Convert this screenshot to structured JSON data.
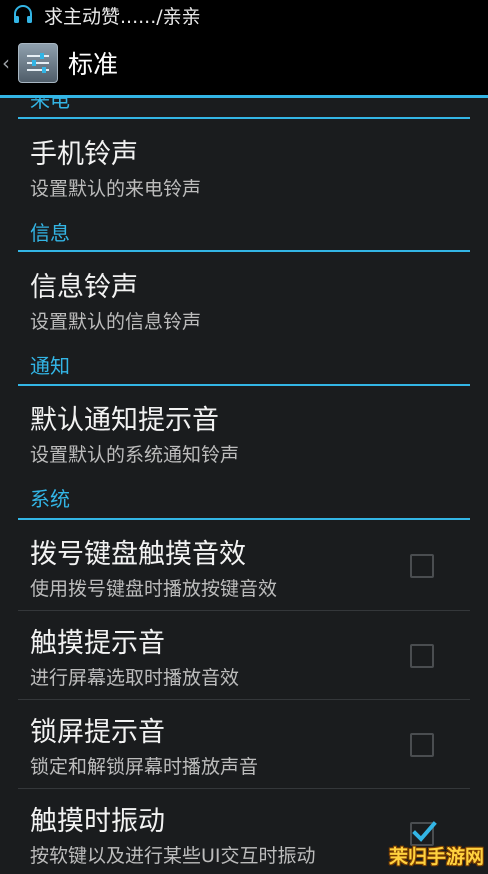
{
  "status_bar": {
    "notification_text": "求主动赞....../亲亲",
    "icon": "headset-icon"
  },
  "action_bar": {
    "back_icon": "chevron-left-icon",
    "app_icon": "settings-sliders-icon",
    "title": "标准"
  },
  "sections": {
    "incoming": {
      "header": "来电"
    },
    "messages": {
      "header": "信息"
    },
    "notify": {
      "header": "通知"
    },
    "system": {
      "header": "系统"
    }
  },
  "items": {
    "phone_ringtone": {
      "title": "手机铃声",
      "summary": "设置默认的来电铃声"
    },
    "message_ringtone": {
      "title": "信息铃声",
      "summary": "设置默认的信息铃声"
    },
    "notification_sound": {
      "title": "默认通知提示音",
      "summary": "设置默认的系统通知铃声"
    },
    "dialpad_tones": {
      "title": "拨号键盘触摸音效",
      "summary": "使用拨号键盘时播放按键音效",
      "checked": false
    },
    "touch_sounds": {
      "title": "触摸提示音",
      "summary": "进行屏幕选取时播放音效",
      "checked": false
    },
    "lock_sound": {
      "title": "锁屏提示音",
      "summary": "锁定和解锁屏幕时播放声音",
      "checked": false
    },
    "haptic_feedback": {
      "title": "触摸时振动",
      "summary": "按软键以及进行某些UI交互时振动",
      "checked": true
    }
  },
  "watermark": "茉归手游网",
  "colors": {
    "accent": "#33b5e5",
    "background": "#1a1c1e",
    "bar": "#000000"
  }
}
